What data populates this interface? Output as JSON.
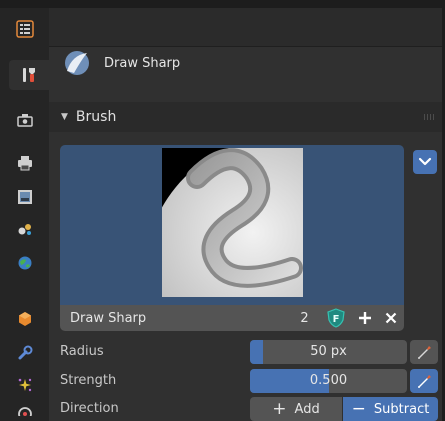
{
  "header": {
    "brush_name": "Draw Sharp"
  },
  "sidebar": {
    "tabs": [
      {
        "name": "tool-icon"
      },
      {
        "name": "render-icon"
      },
      {
        "name": "output-icon"
      },
      {
        "name": "view-layer-icon"
      },
      {
        "name": "scene-icon"
      },
      {
        "name": "world-icon"
      },
      {
        "name": "object-icon"
      },
      {
        "name": "modifier-icon"
      },
      {
        "name": "particles-icon"
      },
      {
        "name": "physics-icon"
      }
    ]
  },
  "panel": {
    "title": "Brush",
    "brush_field": {
      "value": "Draw Sharp",
      "users": "2"
    },
    "fake_user_letter": "F"
  },
  "properties": {
    "radius": {
      "label": "Radius",
      "value": "50 px",
      "fill_fraction": 0.08
    },
    "strength": {
      "label": "Strength",
      "value": "0.500",
      "fill_fraction": 0.5
    },
    "direction": {
      "label": "Direction",
      "add_label": "Add",
      "subtract_label": "Subtract",
      "selected": "Subtract"
    }
  },
  "colors": {
    "accent": "#4772b3",
    "preview_bg": "#385376",
    "field": "#545454",
    "panel": "#303030"
  }
}
